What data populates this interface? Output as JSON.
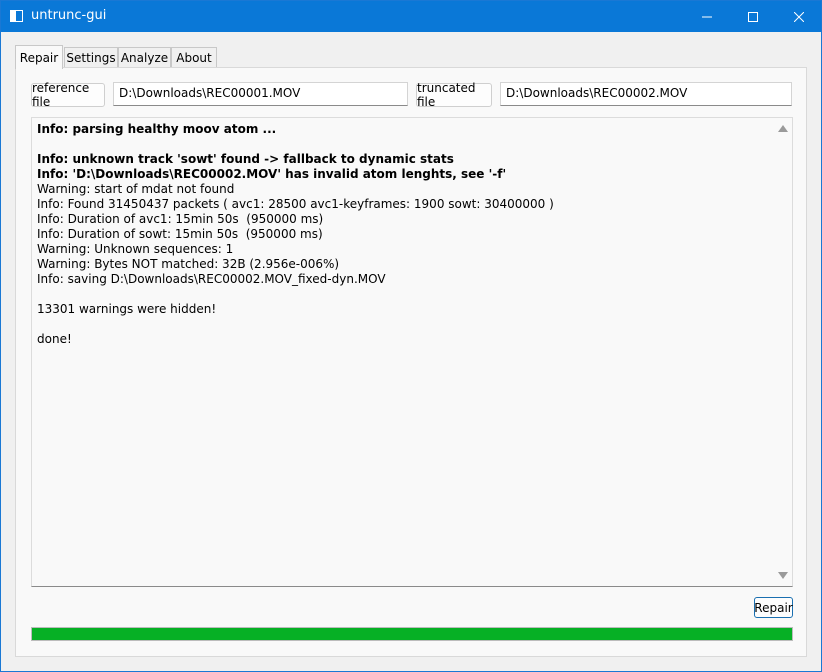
{
  "window": {
    "title": "untrunc-gui",
    "accent_color": "#0a78d7"
  },
  "tabs": [
    {
      "label": "Repair",
      "active": true
    },
    {
      "label": "Settings",
      "active": false
    },
    {
      "label": "Analyze",
      "active": false
    },
    {
      "label": "About",
      "active": false
    }
  ],
  "repair": {
    "reference_button_label": "reference file",
    "reference_path": "D:\\Downloads\\REC00001.MOV",
    "truncated_button_label": "truncated file",
    "truncated_path": "D:\\Downloads\\REC00002.MOV",
    "repair_button_label": "Repair",
    "progress_percent": 100,
    "progress_color": "#06b025",
    "log": [
      {
        "text": "Info: parsing healthy moov atom ...",
        "bold": true
      },
      {
        "text": "",
        "bold": false
      },
      {
        "text": "Info: unknown track 'sowt' found -> fallback to dynamic stats",
        "bold": true
      },
      {
        "text": "Info: 'D:\\Downloads\\REC00002.MOV' has invalid atom lenghts, see '-f'",
        "bold": true
      },
      {
        "text": "Warning: start of mdat not found",
        "bold": false
      },
      {
        "text": "Info: Found 31450437 packets ( avc1: 28500 avc1-keyframes: 1900 sowt: 30400000 )",
        "bold": false
      },
      {
        "text": "Info: Duration of avc1: 15min 50s  (950000 ms)",
        "bold": false
      },
      {
        "text": "Info: Duration of sowt: 15min 50s  (950000 ms)",
        "bold": false
      },
      {
        "text": "Warning: Unknown sequences: 1",
        "bold": false
      },
      {
        "text": "Warning: Bytes NOT matched: 32B (2.956e-006%)",
        "bold": false
      },
      {
        "text": "Info: saving D:\\Downloads\\REC00002.MOV_fixed-dyn.MOV",
        "bold": false
      },
      {
        "text": "",
        "bold": false
      },
      {
        "text": "13301 warnings were hidden!",
        "bold": false
      },
      {
        "text": "",
        "bold": false
      },
      {
        "text": "done!",
        "bold": false
      }
    ]
  }
}
